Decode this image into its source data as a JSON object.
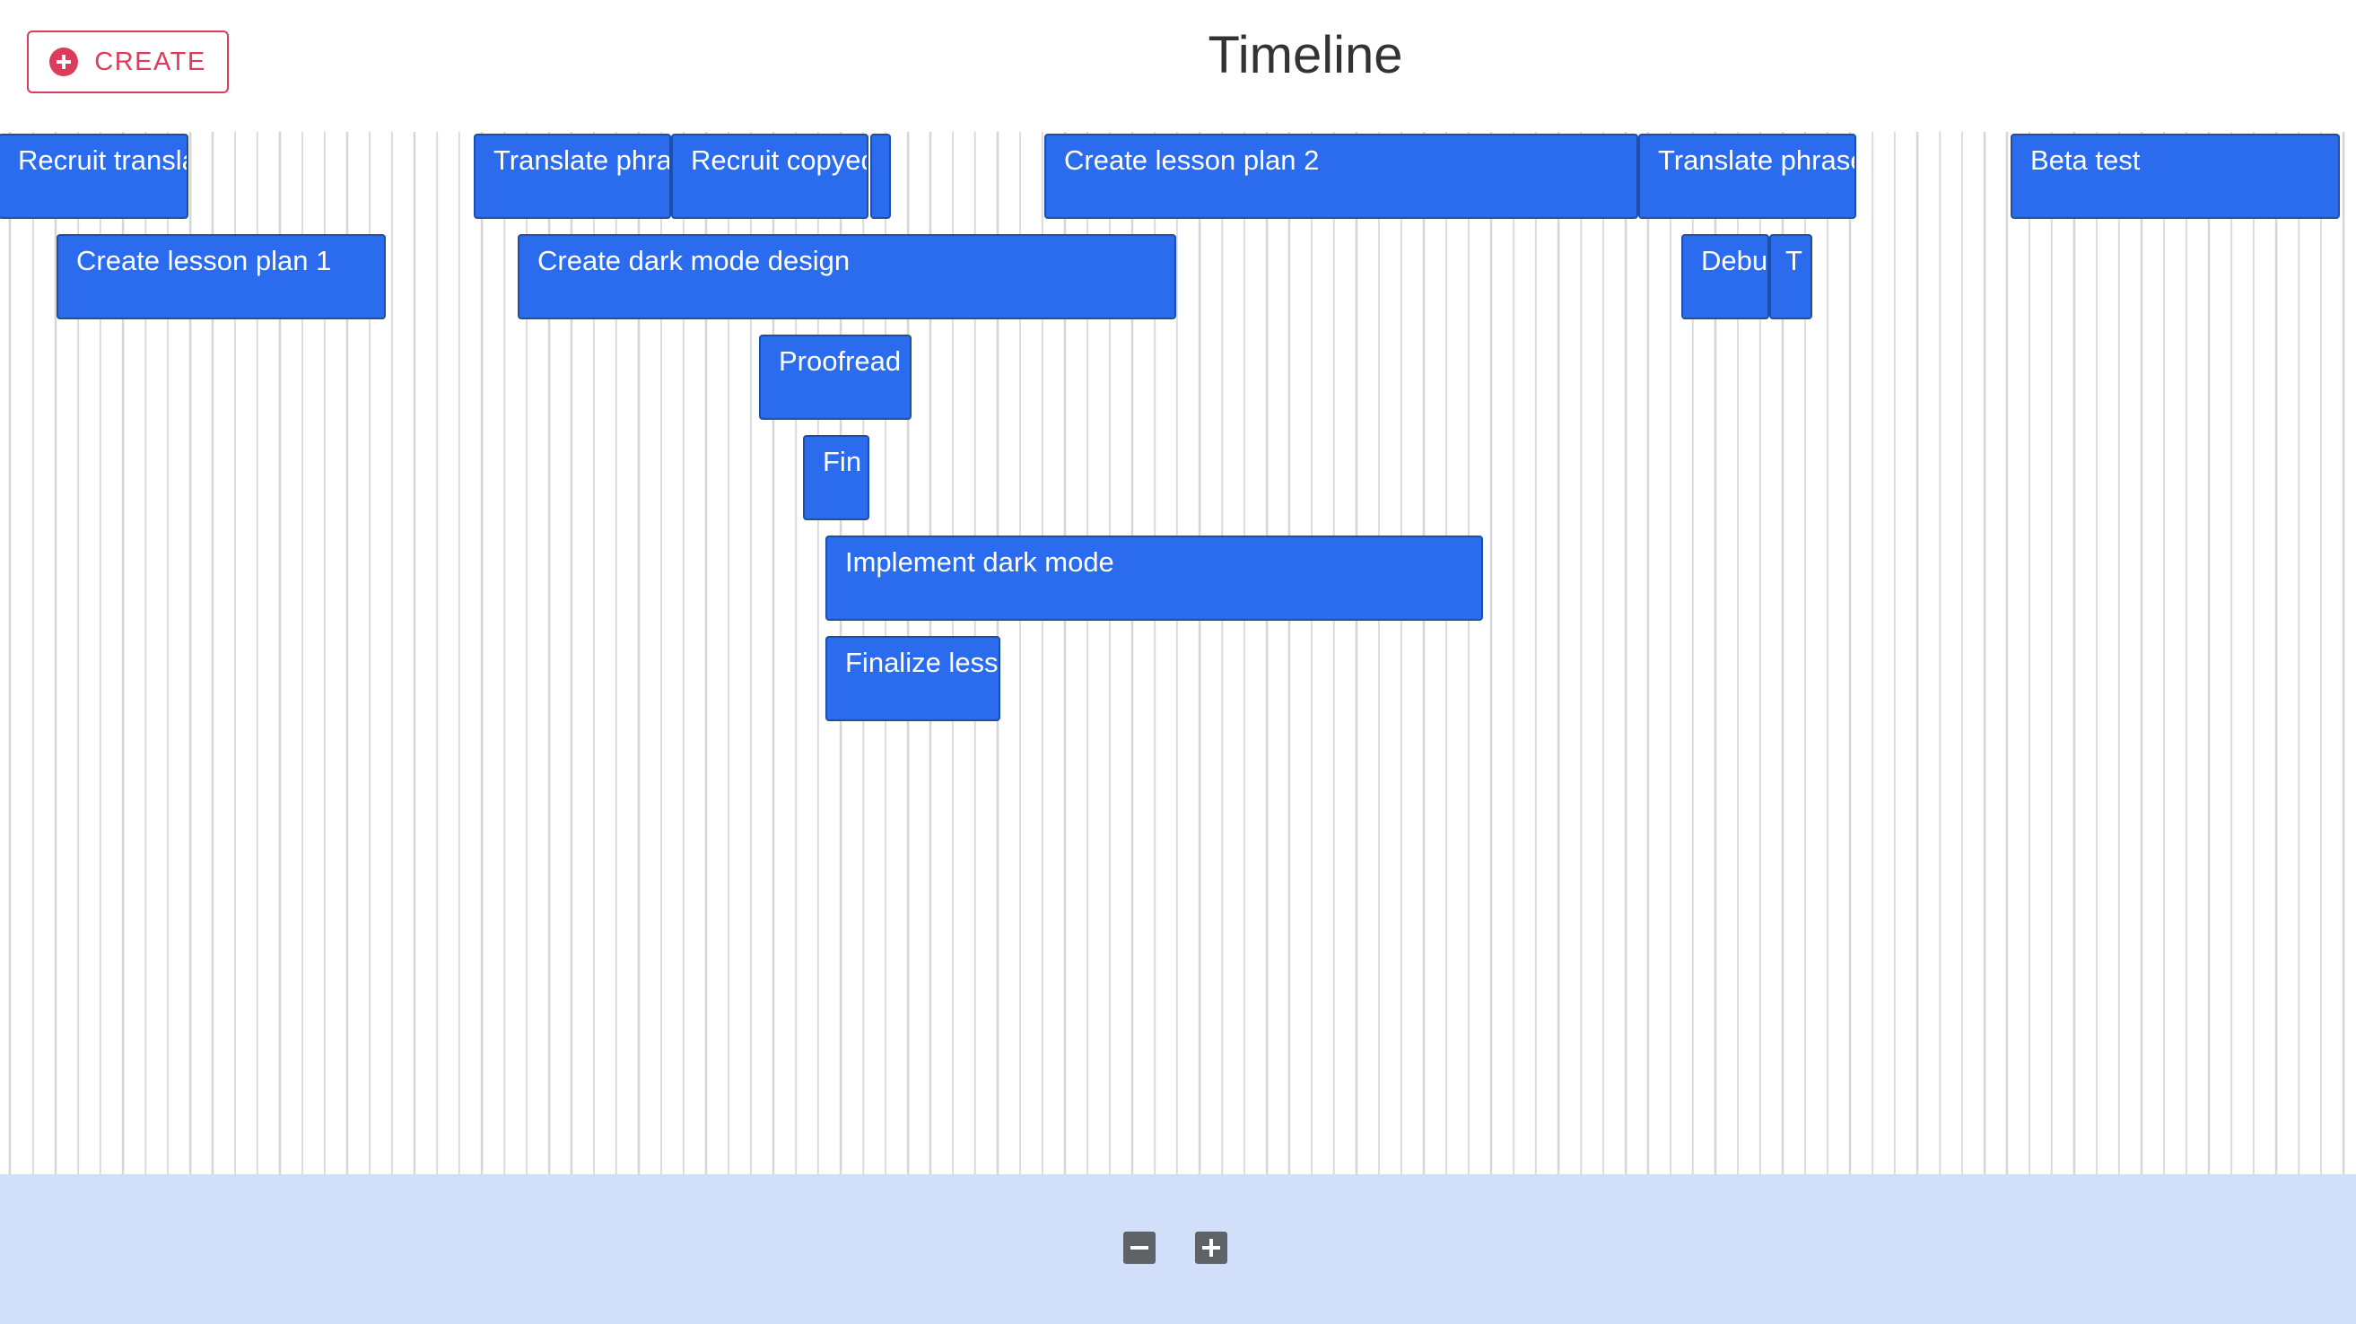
{
  "header": {
    "create_label": "CREATE",
    "create_icon": "plus-circle-icon",
    "title": "Timeline"
  },
  "colors": {
    "accent": "#dc3b5b",
    "task_bar": "#2a6ced",
    "task_border": "#1e4fa8",
    "footer": "#d2dffa",
    "grid_line": "#d6d6d6"
  },
  "tasks": [
    {
      "label": "Recruit translators"
    },
    {
      "label": "Translate phrases"
    },
    {
      "label": "Recruit copyeditors"
    },
    {
      "label": ""
    },
    {
      "label": "Create lesson plan 2"
    },
    {
      "label": "Translate phrases"
    },
    {
      "label": "Beta test"
    },
    {
      "label": "Create lesson plan 1"
    },
    {
      "label": "Create dark mode design"
    },
    {
      "label": "Debug"
    },
    {
      "label": "T"
    },
    {
      "label": "Proofread"
    },
    {
      "label": "Fin"
    },
    {
      "label": "Implement dark mode"
    },
    {
      "label": "Finalize lesson"
    }
  ],
  "footer": {
    "zoom_out_icon": "minus-icon",
    "zoom_in_icon": "plus-icon"
  }
}
